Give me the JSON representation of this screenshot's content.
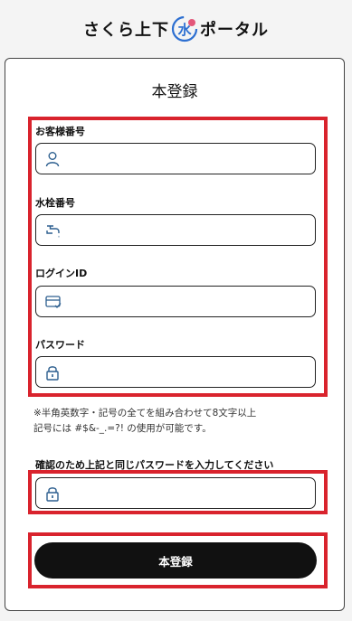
{
  "header": {
    "logo_text_left": "さくら上下",
    "logo_text_right": "ポータル",
    "logo_mark_char": "水"
  },
  "form": {
    "title": "本登録",
    "fields": [
      {
        "label": "お客様番号",
        "icon": "person-icon",
        "value": ""
      },
      {
        "label": "水栓番号",
        "icon": "faucet-icon",
        "value": ""
      },
      {
        "label": "ログインID",
        "icon": "id-card-icon",
        "value": ""
      },
      {
        "label": "パスワード",
        "icon": "lock-icon",
        "value": ""
      }
    ],
    "password_note_line1": "※半角英数字・記号の全てを組み合わせて8文字以上",
    "password_note_line2": "記号には #$&-_.=?! の使用が可能です。",
    "confirm_label": "確認のため上記と同じパスワードを入力してください",
    "confirm_icon": "lock-icon",
    "submit_label": "本登録"
  },
  "colors": {
    "highlight": "#d9232d",
    "button_bg": "#111111",
    "logo_blue": "#2d6fd1",
    "logo_pink": "#e3577a"
  }
}
